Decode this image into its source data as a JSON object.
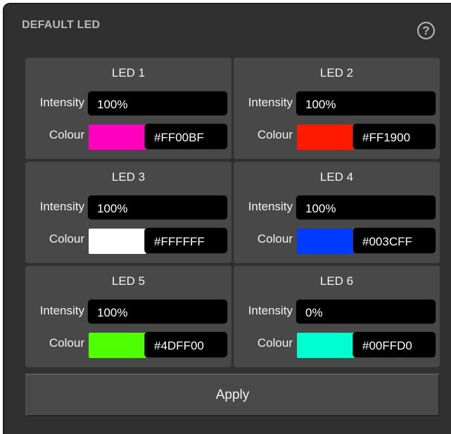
{
  "panel": {
    "title": "DEFAULT LED",
    "help_glyph": "?"
  },
  "labels": {
    "intensity": "Intensity",
    "colour": "Colour"
  },
  "leds": [
    {
      "name": "LED 1",
      "intensity": "100%",
      "hex": "#FF00BF",
      "color": "#FF00BF"
    },
    {
      "name": "LED 2",
      "intensity": "100%",
      "hex": "#FF1900",
      "color": "#FF1900"
    },
    {
      "name": "LED 3",
      "intensity": "100%",
      "hex": "#FFFFFF",
      "color": "#FFFFFF"
    },
    {
      "name": "LED 4",
      "intensity": "100%",
      "hex": "#003CFF",
      "color": "#003CFF"
    },
    {
      "name": "LED 5",
      "intensity": "100%",
      "hex": "#4DFF00",
      "color": "#4DFF00"
    },
    {
      "name": "LED 6",
      "intensity": "0%",
      "hex": "#00FFD0",
      "color": "#00FFD0"
    }
  ],
  "apply_label": "Apply"
}
